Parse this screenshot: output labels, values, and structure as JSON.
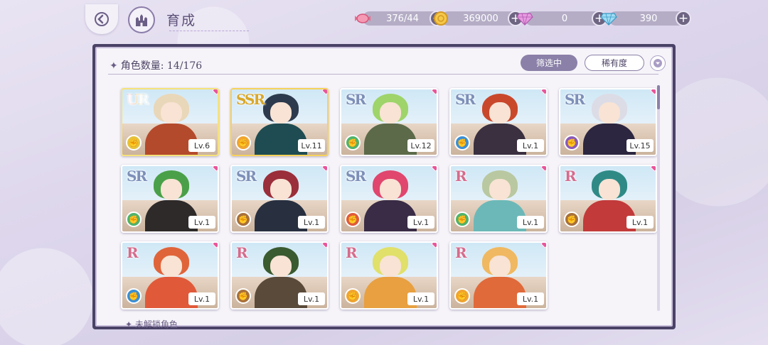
{
  "header": {
    "title": "育成",
    "back_icon": "back-arrow-icon",
    "home_icon": "castle-icon"
  },
  "resources": [
    {
      "name": "stamina",
      "icon": "candy-icon",
      "value": "376/44",
      "color": "#e86f8e"
    },
    {
      "name": "gold",
      "icon": "coin-icon",
      "value": "369000",
      "color": "#f0b83a"
    },
    {
      "name": "pink-gem",
      "icon": "pink-diamond-icon",
      "value": "0",
      "color": "#d97bd0"
    },
    {
      "name": "blue-gem",
      "icon": "blue-diamond-icon",
      "value": "390",
      "color": "#6cc6e8"
    }
  ],
  "panel": {
    "count_label": "角色数量:",
    "count_value": "14/176",
    "filter_label": "筛选中",
    "rarity_label": "稀有度",
    "sort_icon": "chevron-down-icon",
    "bottom_label": "未解锁角色"
  },
  "cards": [
    {
      "rarity": "UR",
      "level": "Lv.6",
      "element": "earth",
      "elem_color": "#e6c23a",
      "hair": "#e9d7b9",
      "body": "#b44a2c"
    },
    {
      "rarity": "SSR",
      "level": "Lv.11",
      "element": "fire",
      "elem_color": "#f0a530",
      "hair": "#2d3a4d",
      "body": "#1f4c52"
    },
    {
      "rarity": "SR",
      "level": "Lv.12",
      "element": "wind",
      "elem_color": "#4fb36a",
      "hair": "#9ed46a",
      "body": "#5c6a4a"
    },
    {
      "rarity": "SR",
      "level": "Lv.1",
      "element": "water",
      "elem_color": "#3a8fd6",
      "hair": "#c9482c",
      "body": "#3a3040"
    },
    {
      "rarity": "SR",
      "level": "Lv.15",
      "element": "dark",
      "elem_color": "#8a5ab8",
      "hair": "#dcdce6",
      "body": "#2c2640"
    },
    {
      "rarity": "SR",
      "level": "Lv.1",
      "element": "wind",
      "elem_color": "#4fb36a",
      "hair": "#4aa048",
      "body": "#2e2a2a"
    },
    {
      "rarity": "SR",
      "level": "Lv.1",
      "element": "earth",
      "elem_color": "#a8703a",
      "hair": "#9a2e3a",
      "body": "#283040"
    },
    {
      "rarity": "SR",
      "level": "Lv.1",
      "element": "fire",
      "elem_color": "#e05a3a",
      "hair": "#e0466e",
      "body": "#3a2c46"
    },
    {
      "rarity": "R",
      "level": "Lv.1",
      "element": "wind",
      "elem_color": "#4fb36a",
      "hair": "#b9c8a0",
      "body": "#6cb8b8"
    },
    {
      "rarity": "R",
      "level": "Lv.1",
      "element": "earth",
      "elem_color": "#a8703a",
      "hair": "#2f8a86",
      "body": "#c23a3a"
    },
    {
      "rarity": "R",
      "level": "Lv.1",
      "element": "water",
      "elem_color": "#3a8fd6",
      "hair": "#e0643a",
      "body": "#e05a3a"
    },
    {
      "rarity": "R",
      "level": "Lv.1",
      "element": "earth",
      "elem_color": "#a8703a",
      "hair": "#3a5a30",
      "body": "#5a4a3a"
    },
    {
      "rarity": "R",
      "level": "Lv.1",
      "element": "fire",
      "elem_color": "#f0a530",
      "hair": "#e0e06a",
      "body": "#e8a040"
    },
    {
      "rarity": "R",
      "level": "Lv.1",
      "element": "fire",
      "elem_color": "#f0a530",
      "hair": "#f0b860",
      "body": "#e06a3a"
    }
  ]
}
